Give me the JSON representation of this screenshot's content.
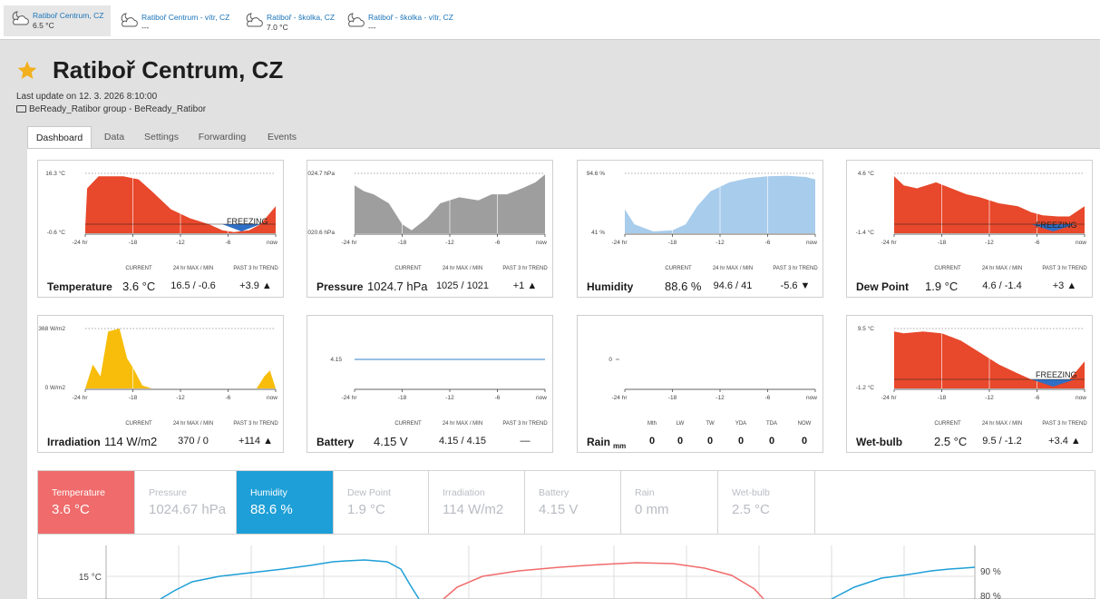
{
  "stations": [
    {
      "name": "Ratiboř Centrum, CZ",
      "value": "6.5 °C",
      "icon": "partly-cloudy-night-icon",
      "active": true
    },
    {
      "name": "Ratiboř Centrum - vítr, CZ",
      "value": "---",
      "icon": "partly-cloudy-night-icon",
      "active": false
    },
    {
      "name": "Ratiboř - školka, CZ",
      "value": "7.0 °C",
      "icon": "partly-cloudy-night-icon",
      "active": false
    },
    {
      "name": "Ratiboř - školka - vítr, CZ",
      "value": "---",
      "icon": "partly-cloudy-night-icon",
      "active": false
    }
  ],
  "header": {
    "title": "Ratiboř Centrum, CZ",
    "favorite": true,
    "last_update": "Last update on 12. 3. 2026 8:10:00",
    "group": "BeReady_Ratibor group - BeReady_Ratibor"
  },
  "tabs": [
    "Dashboard",
    "Data",
    "Settings",
    "Forwarding",
    "Events"
  ],
  "card_headers": {
    "current": "CURRENT",
    "minmax": "24 hr MAX / MIN",
    "trend": "PAST 3 hr TREND"
  },
  "x_ticks": [
    "-24 hr",
    "-18",
    "-12",
    "-6",
    "now"
  ],
  "cards": [
    {
      "label": "Temperature",
      "current": "3.6 °C",
      "minmax": "16.5 / -0.6",
      "trend": "+3.9 ▲",
      "ymax": "16.3 °C",
      "ymin": "-0.6 °C",
      "note": "FREEZING",
      "color": "#e8482b"
    },
    {
      "label": "Pressure",
      "current": "1024.7 hPa",
      "minmax": "1025 / 1021",
      "trend": "+1 ▲",
      "ymax": "1024.7 hPa",
      "ymin": "1020.6 hPa",
      "color": "#9e9e9e"
    },
    {
      "label": "Humidity",
      "current": "88.6 %",
      "minmax": "94.6 / 41",
      "trend": "-5.6 ▼",
      "ymax": "94.6 %",
      "ymin": "41 %",
      "color": "#a8ccec"
    },
    {
      "label": "Dew Point",
      "current": "1.9 °C",
      "minmax": "4.6 / -1.4",
      "trend": "+3 ▲",
      "ymax": "4.6 °C",
      "ymin": "-1.4 °C",
      "note": "FREEZING",
      "color": "#e8482b"
    },
    {
      "label": "Irradiation",
      "current": "114 W/m2",
      "minmax": "370 / 0",
      "trend": "+114 ▲",
      "ymax": "368 W/m2",
      "ymin": "0 W/m2",
      "color": "#f7bd0a"
    },
    {
      "label": "Battery",
      "current": "4.15 V",
      "minmax": "4.15 / 4.15",
      "trend": "—",
      "ylevel": "4.15",
      "color": "#5b9bd5"
    },
    {
      "label": "Rain",
      "unit": "mm",
      "ylevel": "0",
      "rain_cols": [
        "Mth",
        "LW",
        "TW",
        "YDA",
        "TDA",
        "NOW"
      ],
      "rain_vals": [
        "0",
        "0",
        "0",
        "0",
        "0",
        "0"
      ]
    },
    {
      "label": "Wet-bulb",
      "current": "2.5 °C",
      "minmax": "9.5 / -1.2",
      "trend": "+3.4 ▲",
      "ymax": "9.5 °C",
      "ymin": "-1.2 °C",
      "note": "FREEZING",
      "color": "#e8482b"
    }
  ],
  "metrics": [
    {
      "label": "Temperature",
      "value": "3.6 °C",
      "selected": true,
      "color": "#f06b6b"
    },
    {
      "label": "Pressure",
      "value": "1024.67 hPa",
      "selected": false
    },
    {
      "label": "Humidity",
      "value": "88.6 %",
      "selected": true,
      "color": "#1e9fd7"
    },
    {
      "label": "Dew Point",
      "value": "1.9 °C",
      "selected": false
    },
    {
      "label": "Irradiation",
      "value": "114 W/m2",
      "selected": false
    },
    {
      "label": "Battery",
      "value": "4.15 V",
      "selected": false
    },
    {
      "label": "Rain",
      "value": "0 mm",
      "selected": false
    },
    {
      "label": "Wet-bulb",
      "value": "2.5 °C",
      "selected": false
    }
  ],
  "big_chart": {
    "left_axis_label": "15 °C",
    "right_axis_labels": [
      "90 %",
      "80 %"
    ]
  },
  "colors": {
    "blue_link": "#1a73b8",
    "temperature_line": "#f06b6b",
    "humidity_line": "#1e9fd7",
    "freezing_blue": "#2f6fc6"
  }
}
